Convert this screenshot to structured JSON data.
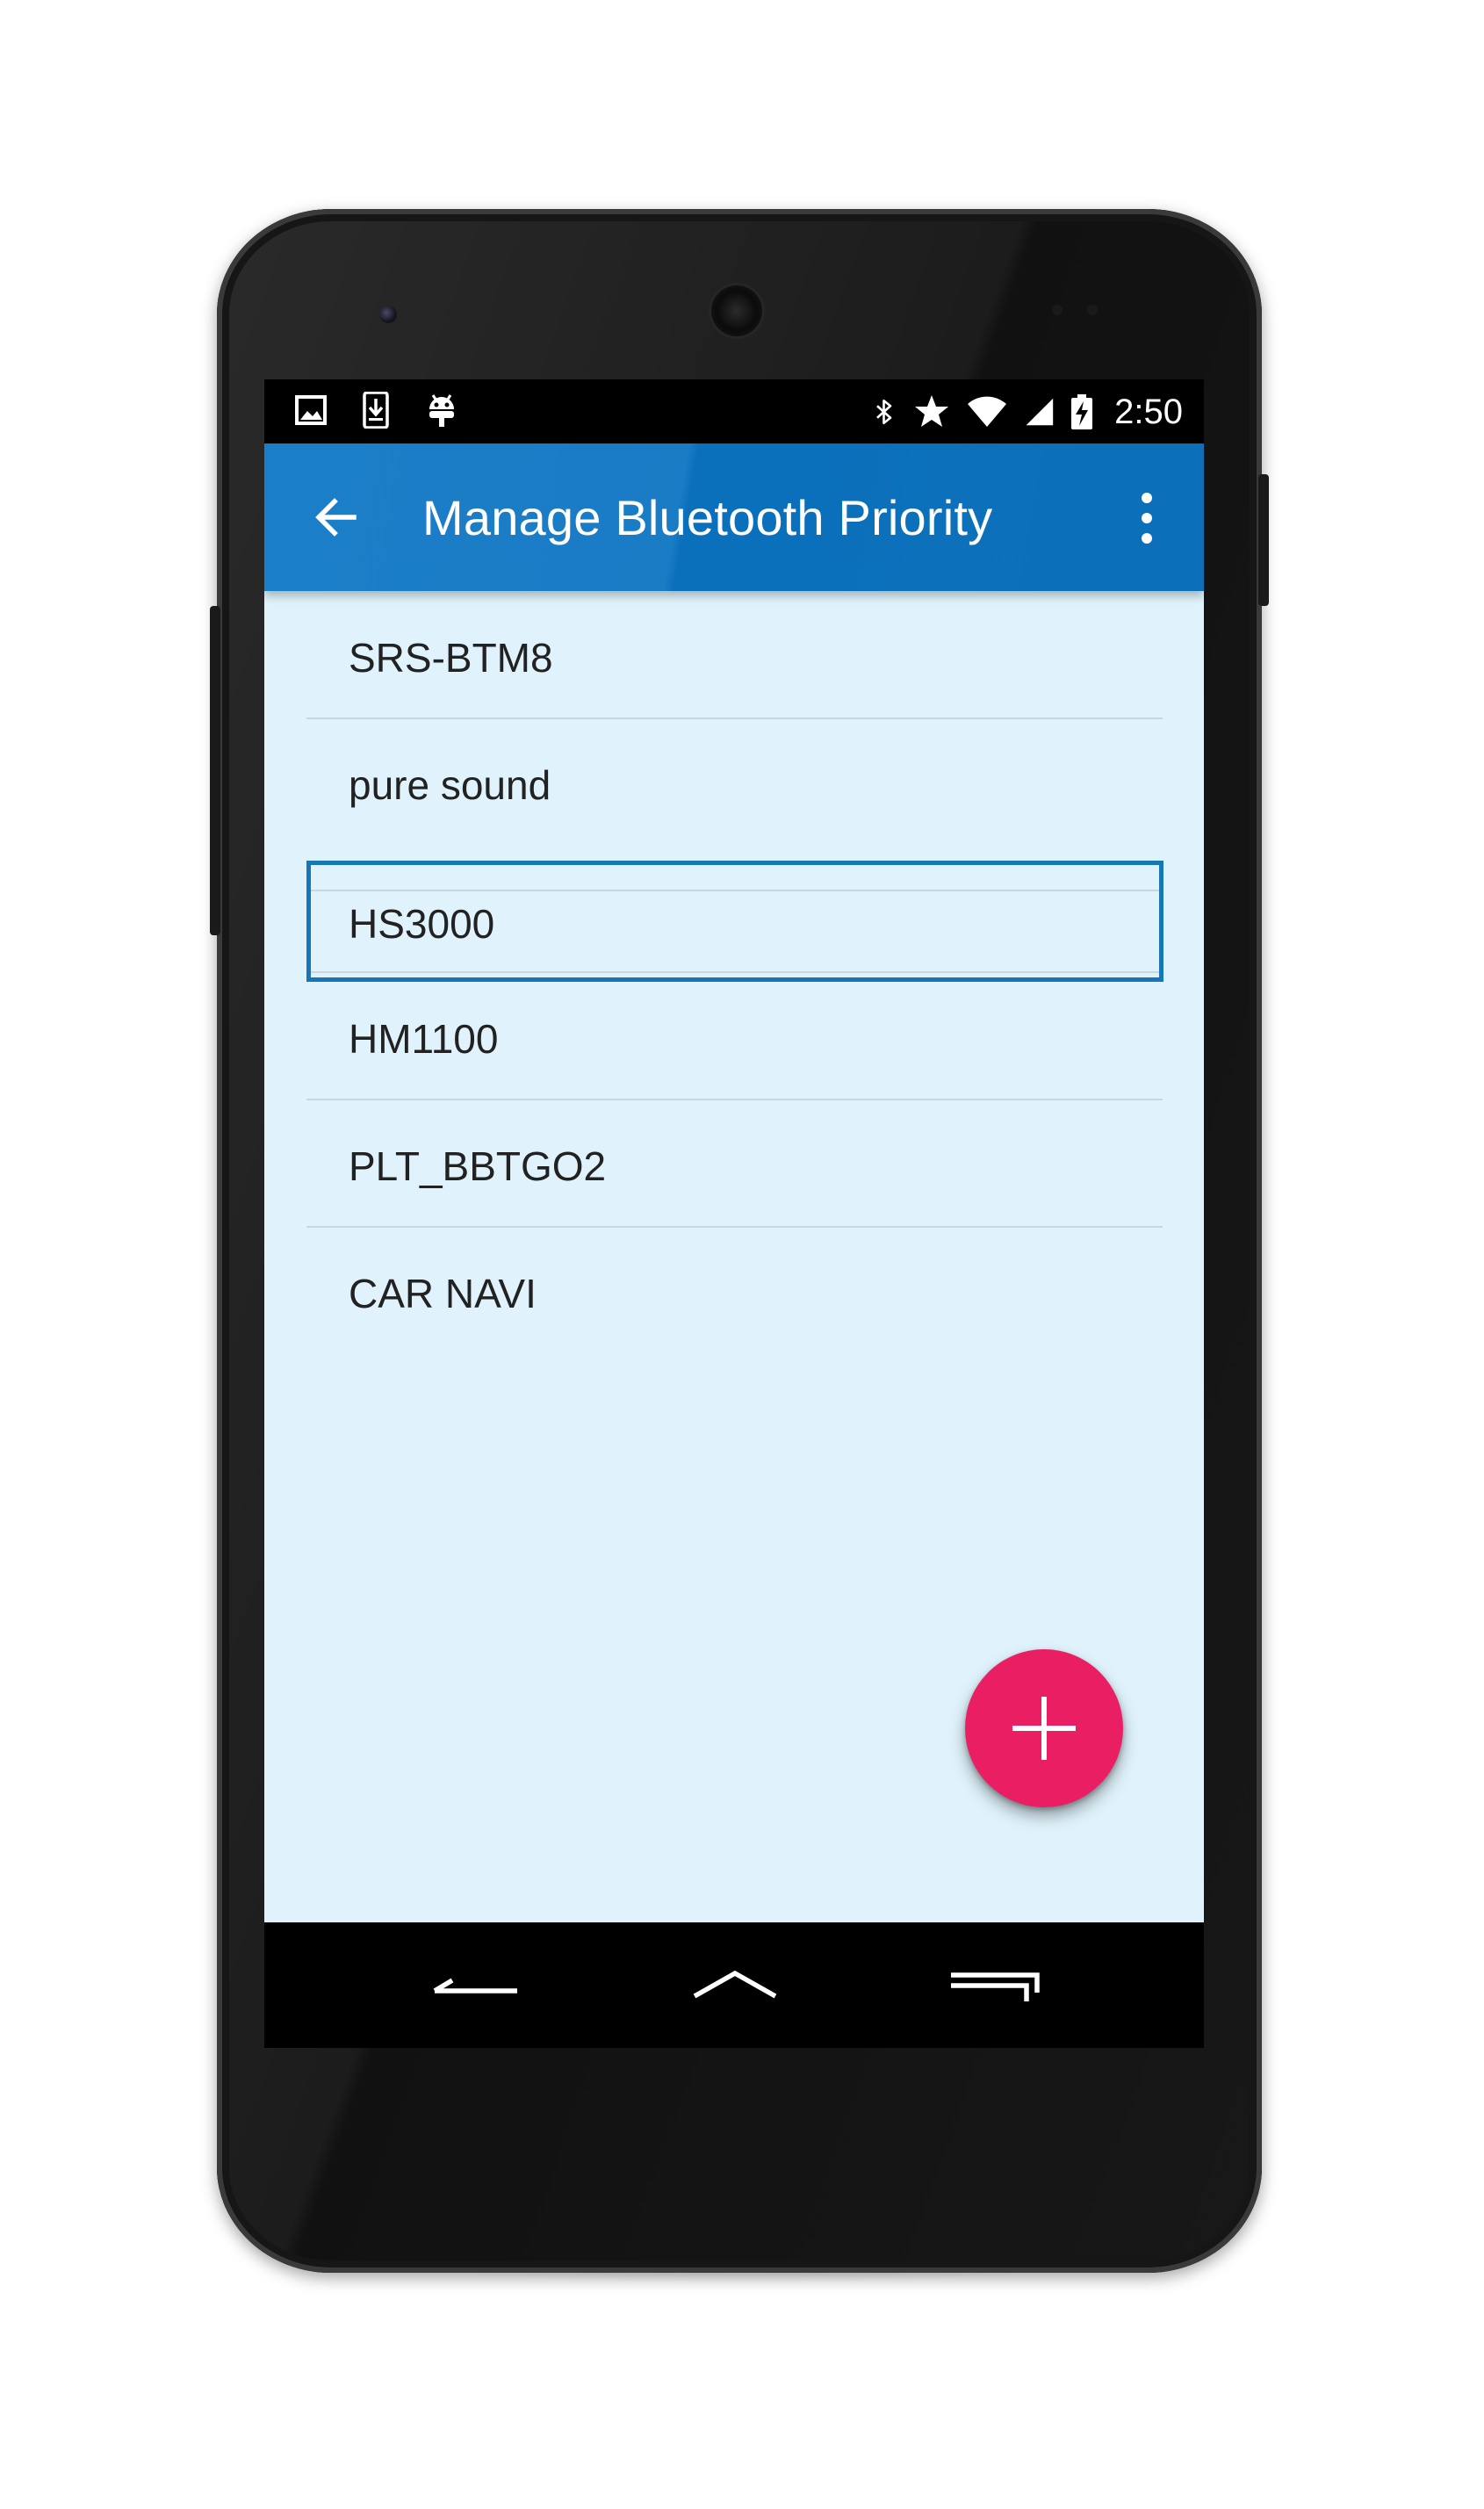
{
  "status_bar": {
    "left_icons": [
      "image-icon",
      "download-icon",
      "android-debug-icon"
    ],
    "right_icons": [
      "bluetooth-icon",
      "star-icon",
      "wifi-icon",
      "cell-signal-icon",
      "battery-charging-icon"
    ],
    "time": "2:50"
  },
  "app_bar": {
    "title": "Manage Bluetooth Priority",
    "back_icon": "arrow-back-icon",
    "menu_icon": "more-vert-icon"
  },
  "devices": [
    {
      "name": "SRS-BTM8"
    },
    {
      "name": "pure sound"
    },
    {
      "name": "HS3000"
    },
    {
      "name": "HM1100"
    },
    {
      "name": "PLT_BBTGO2"
    },
    {
      "name": "CAR NAVI"
    }
  ],
  "fab": {
    "icon": "add-icon",
    "color": "#e91e63"
  },
  "nav_bar": {
    "icons": [
      "nav-back-icon",
      "nav-home-icon",
      "nav-recents-icon"
    ]
  },
  "colors": {
    "app_bar": "#1a7cc5",
    "list_background": "#e0f3fc",
    "drag_highlight": "#1676b8"
  }
}
